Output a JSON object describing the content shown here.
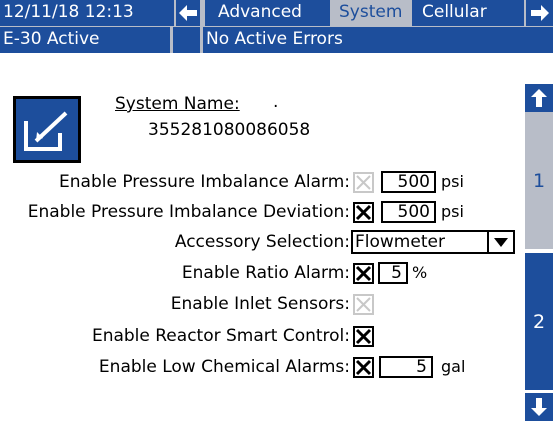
{
  "header": {
    "datetime": "12/11/18 12:13",
    "tabs": [
      {
        "label": "Advanced"
      },
      {
        "label": "System",
        "selected": true
      },
      {
        "label": "Cellular"
      }
    ],
    "status": "E-30 Active",
    "errors": "No Active Errors"
  },
  "system_name": {
    "label": "System Name:",
    "dot": ".",
    "value": "355281080086058"
  },
  "settings": {
    "pressure_alarm": {
      "label": "Enable Pressure Imbalance Alarm:",
      "checked": false,
      "enabled": false,
      "value": "500",
      "unit": "psi"
    },
    "pressure_deviation": {
      "label": "Enable Pressure Imbalance Deviation:",
      "checked": true,
      "value": "500",
      "unit": "psi"
    },
    "accessory": {
      "label": "Accessory Selection:",
      "value": "Flowmeter"
    },
    "ratio_alarm": {
      "label": "Enable Ratio Alarm:",
      "checked": true,
      "value": "5",
      "unit": "%"
    },
    "inlet_sensors": {
      "label": "Enable Inlet Sensors:",
      "checked": false,
      "enabled": false
    },
    "smart_control": {
      "label": "Enable Reactor Smart Control:",
      "checked": true
    },
    "low_chemical": {
      "label": "Enable Low Chemical Alarms:",
      "checked": true,
      "value": "5",
      "unit": "gal"
    }
  },
  "sidebar": {
    "page1": "1",
    "page2": "2"
  },
  "colors": {
    "accent": "#1d4e9c",
    "tab_bg": "#b8bdc8",
    "disabled": "#c8c8c8"
  }
}
